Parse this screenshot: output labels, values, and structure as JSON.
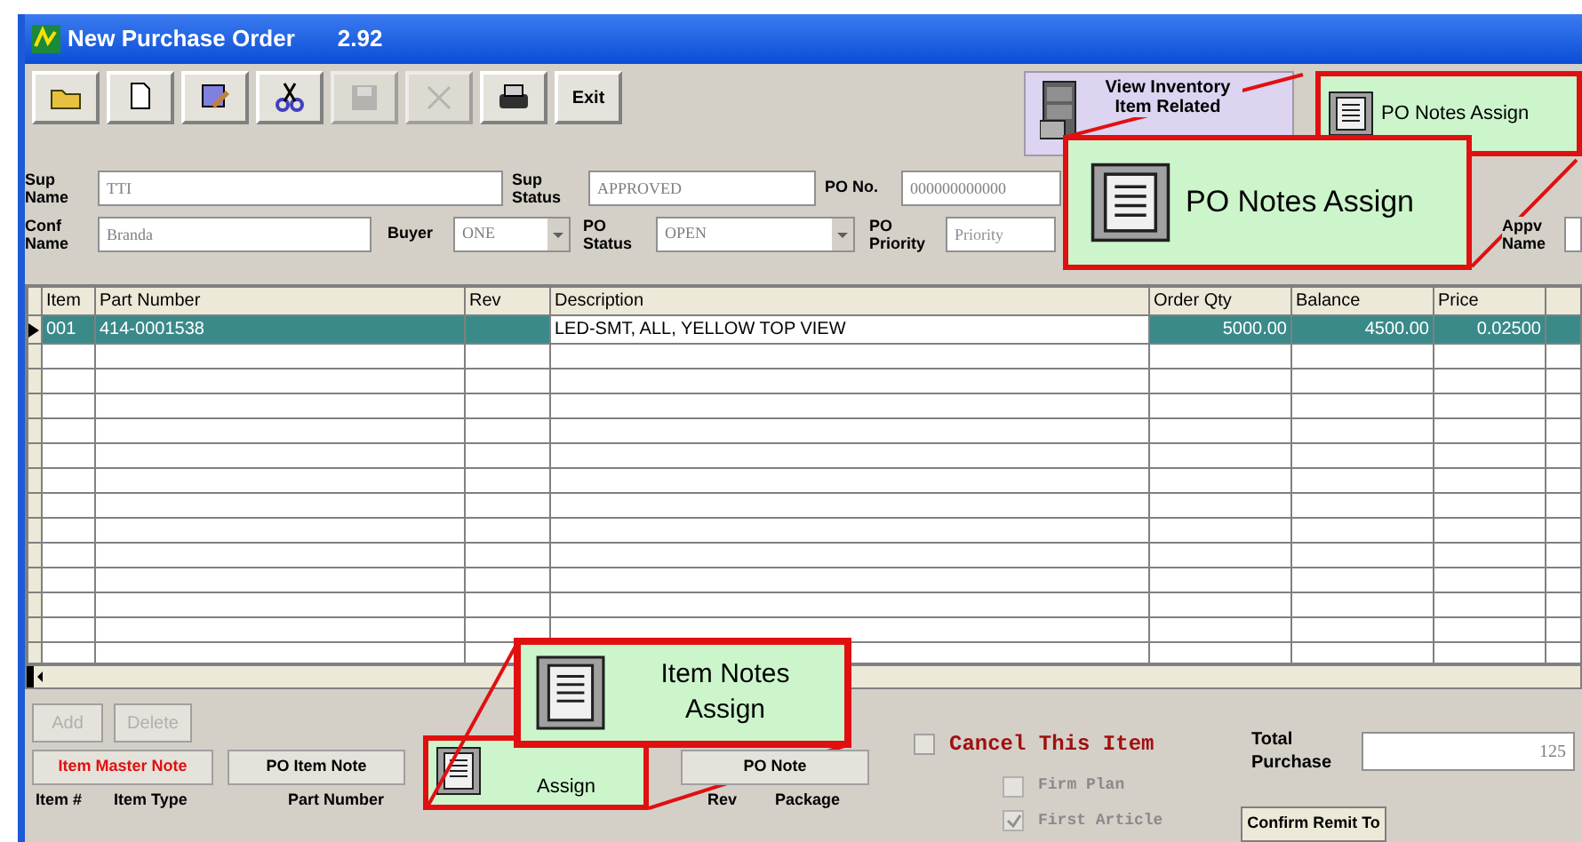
{
  "window": {
    "title": "New Purchase Order",
    "version": "2.92"
  },
  "toolbar": [
    {
      "kind": "open",
      "disabled": false
    },
    {
      "kind": "new",
      "disabled": false
    },
    {
      "kind": "edit",
      "disabled": false
    },
    {
      "kind": "cut",
      "disabled": false
    },
    {
      "kind": "save",
      "disabled": true
    },
    {
      "kind": "delete",
      "disabled": true
    },
    {
      "kind": "print",
      "disabled": false
    },
    {
      "kind": "text",
      "label": "Exit",
      "disabled": false
    }
  ],
  "view_inventory_button": {
    "label": "View Inventory Item Related"
  },
  "po_notes_button": {
    "label": "PO Notes Assign"
  },
  "po_notes_callout": {
    "label": "PO Notes Assign"
  },
  "header_fields": {
    "sup_name": {
      "label": "Sup Name",
      "value": "TTI"
    },
    "sup_status": {
      "label": "Sup Status",
      "value": "APPROVED"
    },
    "po_no": {
      "label": "PO No.",
      "value": "000000000000"
    },
    "conf_name": {
      "label": "Conf Name",
      "value": "Branda"
    },
    "buyer": {
      "label": "Buyer",
      "value": "ONE"
    },
    "po_status": {
      "label": "PO Status",
      "value": "OPEN"
    },
    "po_priority": {
      "label": "PO Priority",
      "placeholder": "Priority"
    },
    "appv_name": {
      "label": "Appv Name"
    }
  },
  "table": {
    "columns": [
      "Item",
      "Part Number",
      "Rev",
      "Description",
      "Order Qty",
      "Balance",
      "Price"
    ],
    "rows": [
      {
        "selected": true,
        "cells": [
          "001",
          "414-0001538",
          "",
          "LED-SMT, ALL, YELLOW TOP VIEW",
          "5000.00",
          "4500.00",
          "0.02500"
        ]
      }
    ]
  },
  "buttons": {
    "add": {
      "label": "Add",
      "disabled": true
    },
    "delete": {
      "label": "Delete",
      "disabled": true
    },
    "item_master_note": {
      "label": "Item Master Note"
    },
    "po_item_note": {
      "label": "PO Item Note"
    },
    "item_notes_button": {
      "label": "Assign"
    },
    "item_notes_callout": {
      "label": "Item Notes Assign"
    },
    "po_note": {
      "label": "PO Note"
    },
    "confirm_remit_to": {
      "label": "Confirm Remit To"
    }
  },
  "cancel_item": {
    "label": "Cancel This Item",
    "checked": false
  },
  "firm_plan": {
    "label": "Firm Plan",
    "checked": false
  },
  "first_article": {
    "label": "First Article",
    "checked": true
  },
  "total_purchase": {
    "label": "Total Purchase",
    "value": "125"
  },
  "item_labels": [
    "Item #",
    "Item Type",
    "Part Number",
    "Rev",
    "Package"
  ]
}
